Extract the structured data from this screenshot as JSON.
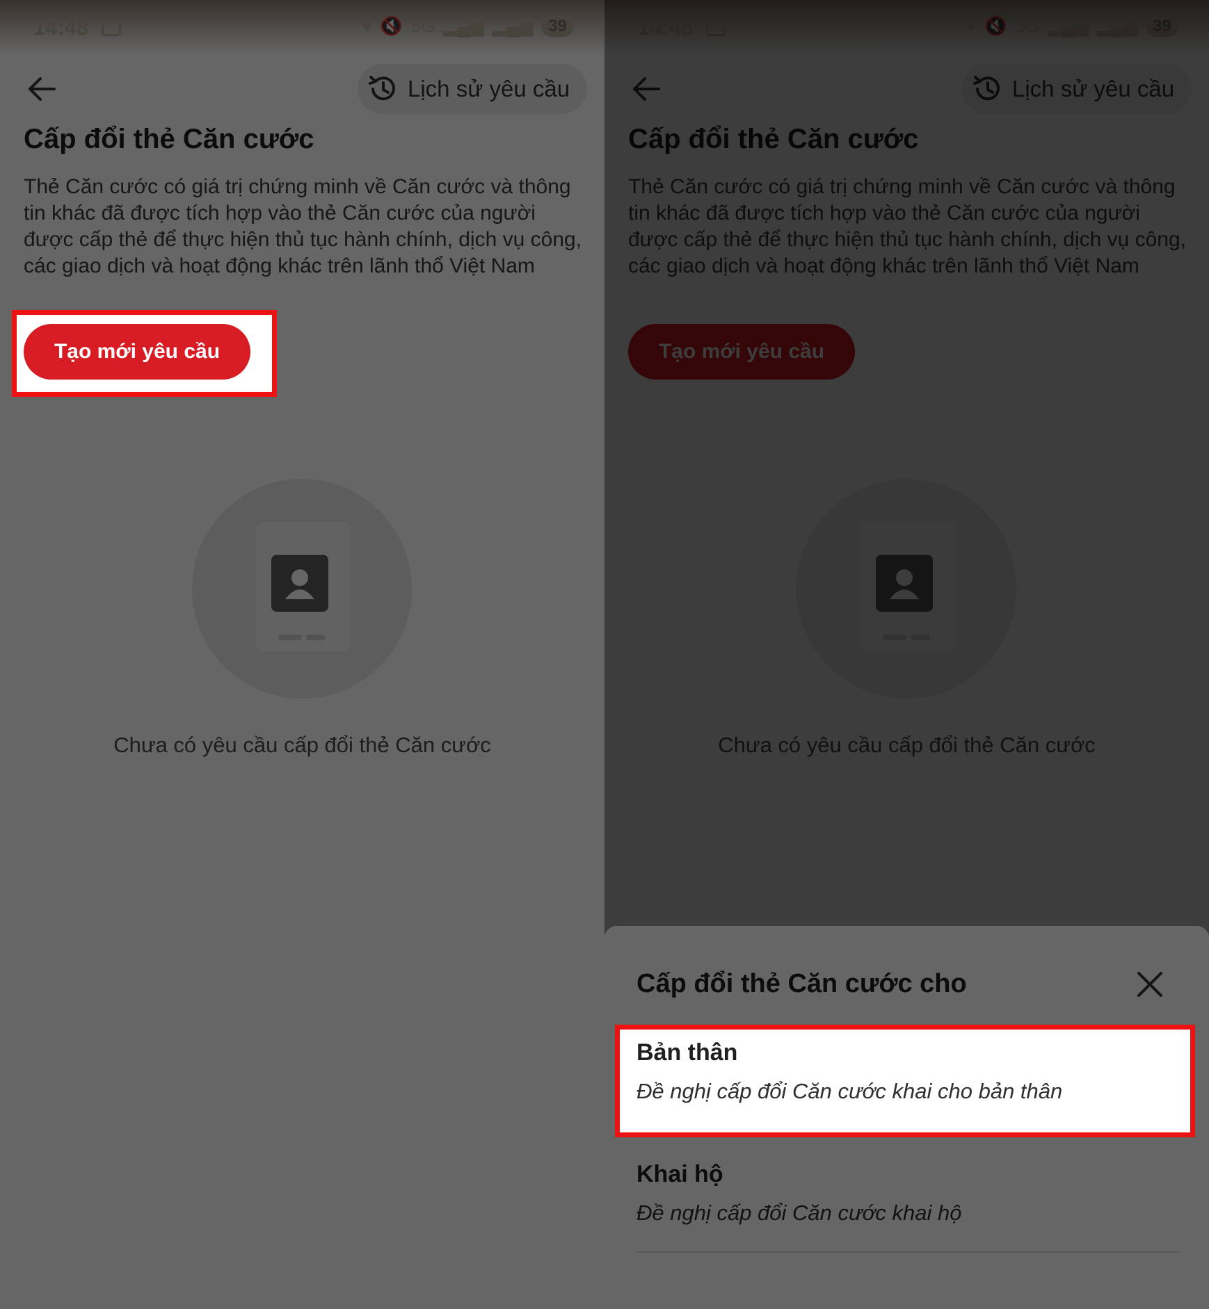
{
  "status": {
    "time": "14:48",
    "battery": "39",
    "network": "5G"
  },
  "header": {
    "history_label": "Lịch sử yêu cầu"
  },
  "page": {
    "title": "Cấp đổi thẻ Căn cước",
    "description": "Thẻ Căn cước có giá trị chứng minh về Căn cước và thông tin khác đã được tích hợp vào thẻ Căn cước của người được cấp thẻ để thực hiện thủ tục hành chính, dịch vụ công, các giao dịch và hoạt động khác trên lãnh thổ Việt Nam",
    "create_label": "Tạo mới yêu cầu",
    "empty_text": "Chưa có yêu cầu cấp đổi thẻ Căn cước"
  },
  "sheet": {
    "title": "Cấp đổi thẻ Căn cước cho",
    "options": [
      {
        "title": "Bản thân",
        "subtitle": "Đề nghị cấp đổi Căn cước khai cho bản thân"
      },
      {
        "title": "Khai hộ",
        "subtitle": "Đề nghị cấp đổi Căn cước khai hộ"
      }
    ]
  },
  "colors": {
    "brand_red": "#d71c24",
    "highlight": "#ee1111"
  }
}
